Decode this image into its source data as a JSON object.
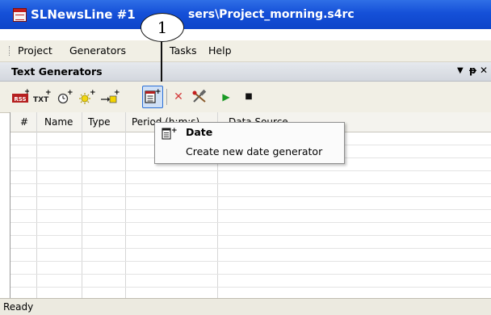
{
  "window": {
    "title_prefix": "SLNewsLine #1",
    "title_suffix": "sers\\Project_morning.s4rc",
    "callout_number": "1"
  },
  "menu": {
    "items": [
      {
        "label": "Project"
      },
      {
        "label": "Generators"
      },
      {
        "label": "Tasks"
      },
      {
        "label": "Help"
      }
    ]
  },
  "panel": {
    "title": "Text Generators",
    "dropdown_glyph": "▼",
    "pin_glyph": "ᵽ",
    "close_glyph": "✕"
  },
  "toolbar": {
    "buttons": [
      {
        "icon": "rss-generator-icon",
        "label": "RSS"
      },
      {
        "icon": "text-generator-icon",
        "label": "TXT"
      },
      {
        "icon": "clock-generator-icon",
        "label": "⊙"
      },
      {
        "icon": "sun-generator-icon",
        "label": "☼"
      },
      {
        "icon": "counter-generator-icon",
        "label": "→"
      },
      {
        "icon": "date-generator-icon",
        "label": "Date",
        "active": true
      },
      {
        "icon": "delete-icon",
        "label": "✕"
      },
      {
        "icon": "tools-icon",
        "label": "⚒"
      },
      {
        "icon": "play-icon",
        "label": "▶"
      },
      {
        "icon": "stop-icon",
        "label": "■"
      }
    ]
  },
  "grid": {
    "columns": [
      "#",
      "Name",
      "Type",
      "Period (h:m:s)",
      "Data Source"
    ]
  },
  "dropdown": {
    "title": "Date",
    "subtitle": "Create new date generator"
  },
  "status": {
    "text": "Ready"
  },
  "colors": {
    "title_bar": "#1550d8",
    "menu_bg": "#f1efe5",
    "active_button": "#cfe0f6",
    "play_green": "#1a9a24"
  }
}
